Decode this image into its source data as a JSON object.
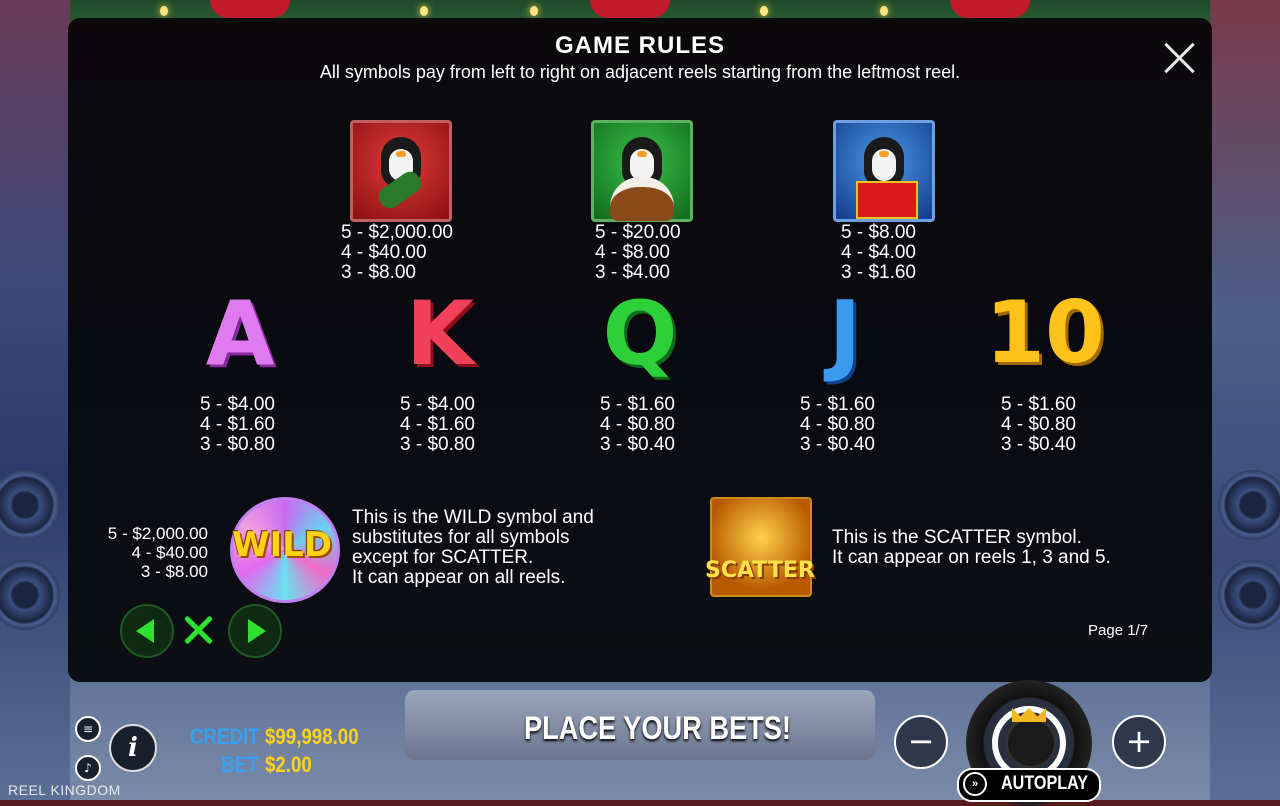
{
  "modal": {
    "title": "GAME RULES",
    "subtitle": "All symbols pay from left to right on adjacent reels starting from the leftmost reel.",
    "page": "Page 1/7"
  },
  "premium_symbols": [
    {
      "icon": "penguin-champagne-icon",
      "color": "#c21a1a",
      "pays": [
        "5 - $2,000.00",
        "4 - $40.00",
        "3 - $8.00"
      ]
    },
    {
      "icon": "penguin-cake-icon",
      "color": "#1f8a2a",
      "pays": [
        "5 - $20.00",
        "4 - $8.00",
        "3 - $4.00"
      ]
    },
    {
      "icon": "penguin-gift-icon",
      "color": "#1a5ac2",
      "pays": [
        "5 - $8.00",
        "4 - $4.00",
        "3 - $1.60"
      ]
    }
  ],
  "letter_symbols": [
    {
      "letter": "A",
      "color": "#e07af0",
      "pays": [
        "5 - $4.00",
        "4 - $1.60",
        "3 - $0.80"
      ]
    },
    {
      "letter": "K",
      "color": "#f0405a",
      "pays": [
        "5 - $4.00",
        "4 - $1.60",
        "3 - $0.80"
      ]
    },
    {
      "letter": "Q",
      "color": "#2ed03a",
      "pays": [
        "5 - $1.60",
        "4 - $0.80",
        "3 - $0.40"
      ]
    },
    {
      "letter": "J",
      "color": "#3a9af0",
      "pays": [
        "5 - $1.60",
        "4 - $0.80",
        "3 - $0.40"
      ]
    },
    {
      "letter": "10",
      "color": "#ffc21a",
      "pays": [
        "5 - $1.60",
        "4 - $0.80",
        "3 - $0.40"
      ]
    }
  ],
  "wild": {
    "label": "WILD",
    "pays": [
      "5 - $2,000.00",
      "4 - $40.00",
      "3 - $8.00"
    ],
    "desc": [
      "This is the WILD symbol and",
      "substitutes for all symbols",
      "except for SCATTER.",
      "It can appear on all reels."
    ]
  },
  "scatter": {
    "label": "SCATTER",
    "desc": [
      "This is the SCATTER symbol.",
      "It can appear on reels 1, 3 and 5."
    ]
  },
  "bottom_bar": {
    "credit_label": "CREDIT",
    "credit_value": "$99,998.00",
    "bet_label": "BET",
    "bet_value": "$2.00",
    "message": "PLACE YOUR BETS!",
    "autoplay_label": "AUTOPLAY",
    "brand": "REEL KINGDOM",
    "minus": "−",
    "plus": "+",
    "info": "i",
    "menu_icon": "menu-icon",
    "sound_icon": "sound-icon"
  }
}
